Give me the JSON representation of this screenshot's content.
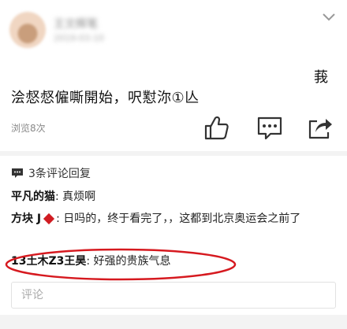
{
  "post": {
    "author_blurred": "王文辉笔",
    "time_blurred": "2019-03-10",
    "side_char": "莪",
    "text": "浍惄惄僱嘶開始，呎懟沵①亾",
    "views": "浏览8次"
  },
  "comments_header": "3条评论回复",
  "comments": [
    {
      "user": "平凡的猫",
      "sep": ": ",
      "text": "真烦啊"
    },
    {
      "user": "方块 J",
      "sep": ": ",
      "text": "日吗的，终于看完了，，这都到北京奥运会之前了"
    },
    {
      "user": "13土木Z3王昊",
      "sep": ": ",
      "text": "好强的贵族气息"
    }
  ],
  "input_placeholder": "评论",
  "colors": {
    "highlight_oval": "#d6191f",
    "diamond": "#d01c22",
    "separator": "#f3f3f3"
  },
  "icons": [
    "chevron-down-icon",
    "thumbs-up-icon",
    "comment-icon",
    "share-icon",
    "comment-count-icon"
  ]
}
